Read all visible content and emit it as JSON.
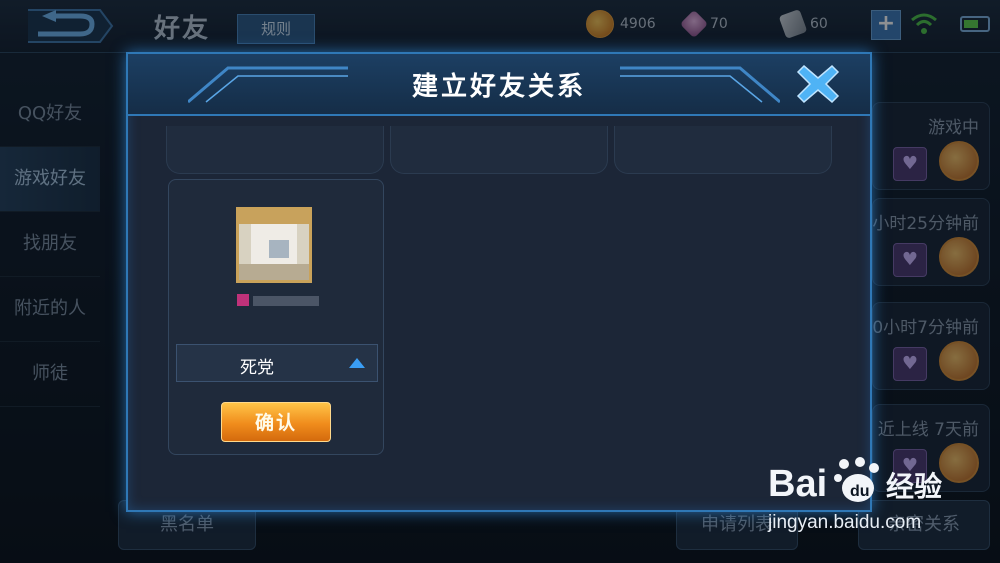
{
  "header": {
    "title": "好友",
    "rules_label": "规则",
    "gold": "4906",
    "gems": "70",
    "tickets": "60",
    "plus_label": "+"
  },
  "sidebar": {
    "items": [
      {
        "label": "QQ好友"
      },
      {
        "label": "游戏好友"
      },
      {
        "label": "找朋友"
      },
      {
        "label": "附近的人"
      },
      {
        "label": "师徒"
      }
    ]
  },
  "friend_list": {
    "statuses": [
      "游戏中",
      "小时25分钟前",
      "0小时7分钟前",
      "近上线  7天前"
    ]
  },
  "bottom": {
    "blacklist_label": "黑名单",
    "apply_list_label": "申请列表",
    "relation_label": "亲密关系"
  },
  "dialog": {
    "title": "建立好友关系",
    "relation_value": "死党",
    "confirm_label": "确认"
  },
  "watermark": {
    "logo_text": "Bai 经验",
    "url": "jingyan.baidu.com"
  },
  "colors": {
    "accent": "#2f78b6",
    "confirm": "#f08c1c",
    "close": "#4fb3f5"
  }
}
